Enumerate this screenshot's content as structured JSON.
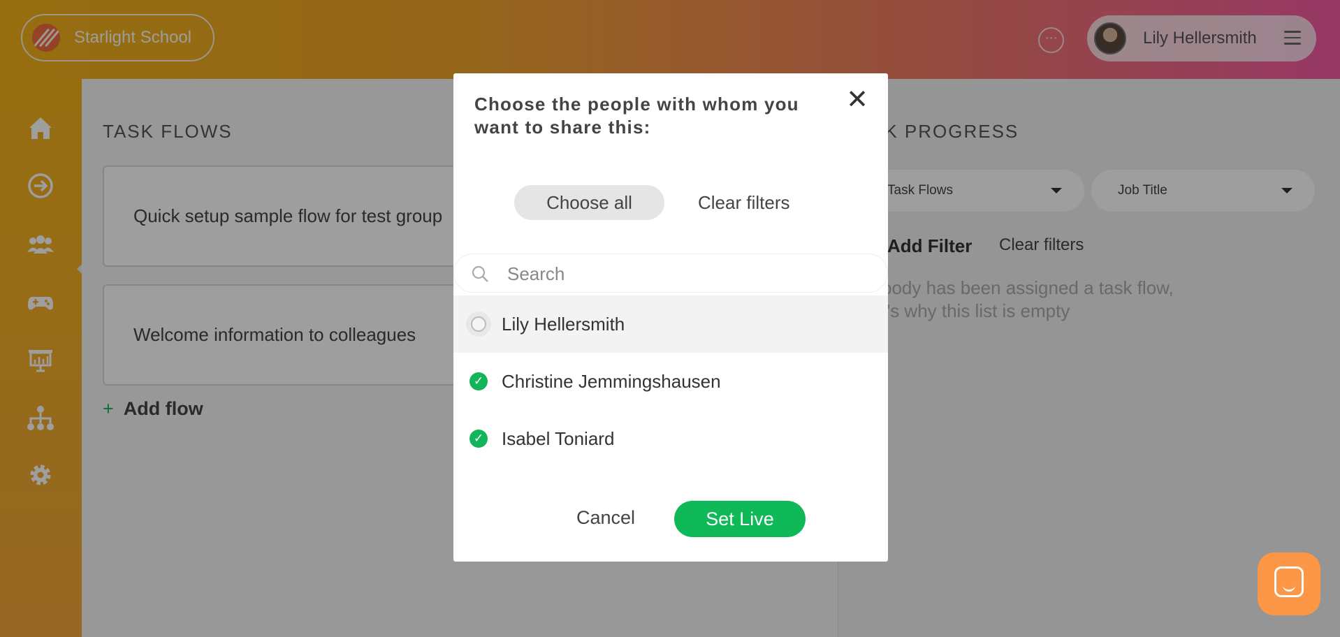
{
  "header": {
    "brand_name": "Starlight School",
    "user_name": "Lily Hellersmith",
    "chat_icon": "ellipsis-circle-icon",
    "menu_icon": "hamburger-icon"
  },
  "sidebar": {
    "items": [
      {
        "icon": "home-icon"
      },
      {
        "icon": "arrow-right-circle-icon"
      },
      {
        "icon": "people-icon"
      },
      {
        "icon": "gamepad-icon"
      },
      {
        "icon": "presentation-icon"
      },
      {
        "icon": "org-chart-icon"
      },
      {
        "icon": "gear-icon"
      }
    ]
  },
  "task_flows": {
    "title": "TASK FLOWS",
    "flows": [
      "Quick setup sample flow for test group",
      "Welcome information to colleagues"
    ],
    "add_label": "Add flow",
    "add_symbol": "+"
  },
  "task_progress": {
    "title": "TASK PROGRESS",
    "title_visible": "SK PROGRESS",
    "dropdown_flows": "Task Flows",
    "dropdown_job": "Job Title",
    "add_filter": "Add Filter",
    "clear_filters": "Clear filters",
    "empty_line1": "body has been assigned a task flow,",
    "empty_line2": "t's why this list is empty"
  },
  "modal": {
    "title": "Choose the people with whom you want to share this:",
    "choose_all": "Choose all",
    "clear_filters": "Clear filters",
    "search_placeholder": "Search",
    "people": [
      {
        "name": "Lily Hellersmith",
        "selected": false
      },
      {
        "name": "Christine Jemmingshausen",
        "selected": true
      },
      {
        "name": "Isabel Toniard",
        "selected": true
      }
    ],
    "cancel": "Cancel",
    "set_live": "Set Live"
  },
  "colors": {
    "accent_green": "#13b55a",
    "header_start": "#f2b21a",
    "header_end": "#f25aa2",
    "help_orange": "#fb9747"
  }
}
